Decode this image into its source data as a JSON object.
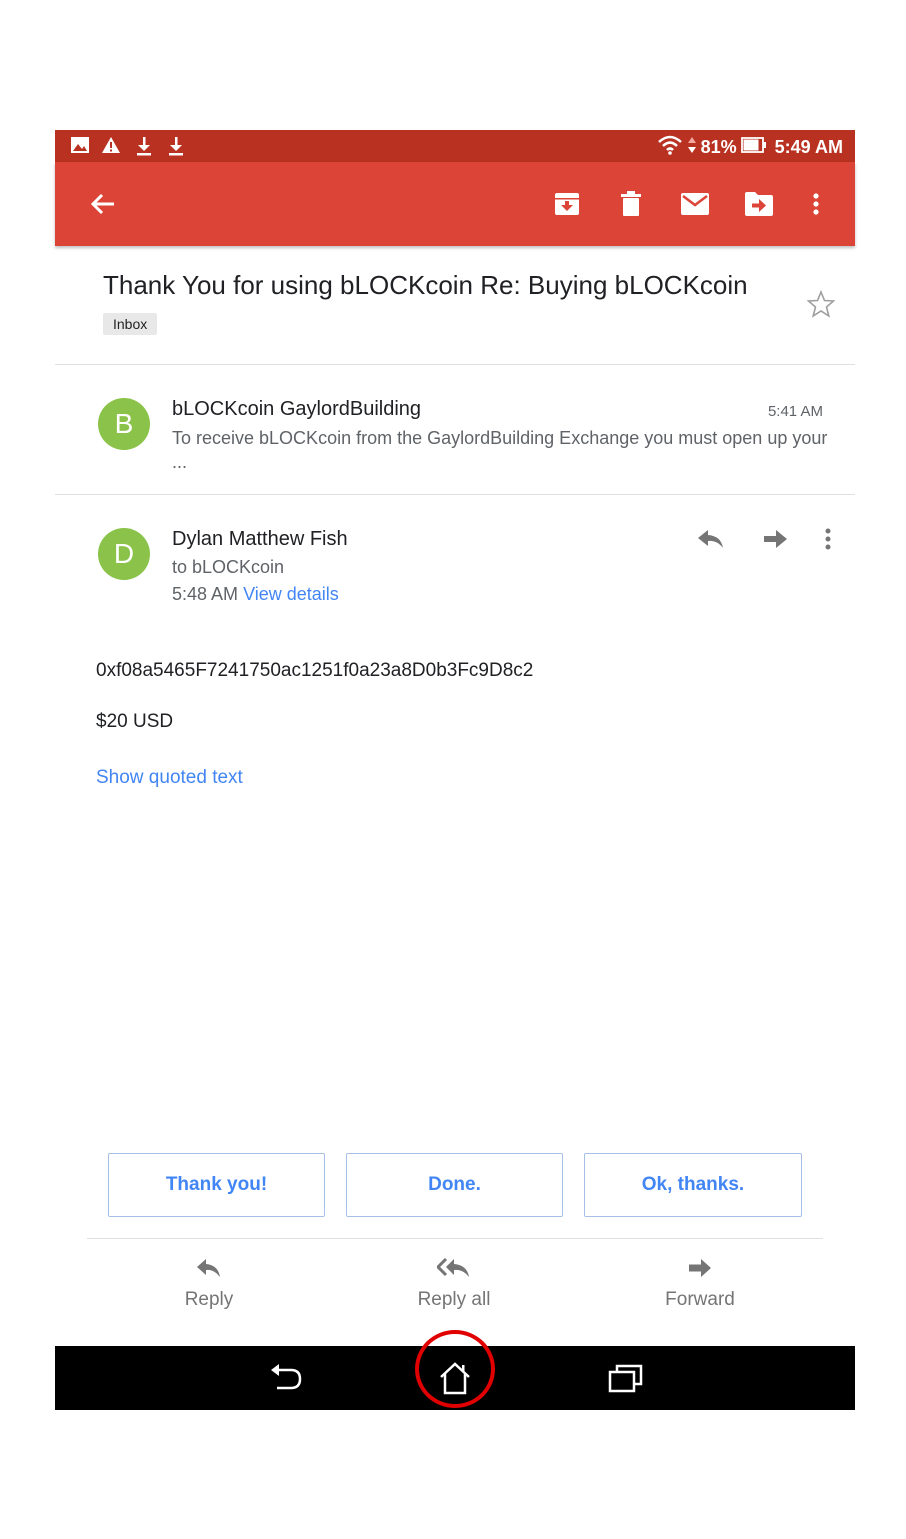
{
  "status_bar": {
    "battery": "81%",
    "time": "5:49 AM",
    "icons": [
      "image-icon",
      "warning-icon",
      "download-icon",
      "download-icon",
      "wifi-icon",
      "battery-icon"
    ]
  },
  "toolbar": {
    "icons": [
      "back-arrow-icon",
      "archive-icon",
      "delete-icon",
      "mark-unread-icon",
      "move-to-icon",
      "more-vert-icon"
    ],
    "color": "#db4437"
  },
  "email": {
    "subject": "Thank You for using bLOCKcoin Re: Buying bLOCKcoin",
    "label": "Inbox"
  },
  "messages": [
    {
      "avatar_letter": "B",
      "sender": "bLOCKcoin GaylordBuilding",
      "time": "5:41 AM",
      "snippet": "To receive bLOCKcoin from the GaylordBuilding Exchange you must open up your ..."
    },
    {
      "avatar_letter": "D",
      "sender": "Dylan Matthew Fish",
      "recipient": "to bLOCKcoin",
      "time": "5:48 AM",
      "view_details": "View details",
      "body_lines": [
        "0xf08a5465F7241750ac1251f0a23a8D0b3Fc9D8c2",
        "$20 USD"
      ],
      "show_quoted": "Show quoted text"
    }
  ],
  "smart_replies": [
    "Thank you!",
    "Done.",
    "Ok, thanks."
  ],
  "bottom_actions": {
    "reply": "Reply",
    "reply_all": "Reply all",
    "forward": "Forward"
  },
  "colors": {
    "status_bar": "#b93221",
    "avatar": "#8bc34a",
    "link": "#4285f4",
    "highlight_ring": "#e00000"
  }
}
